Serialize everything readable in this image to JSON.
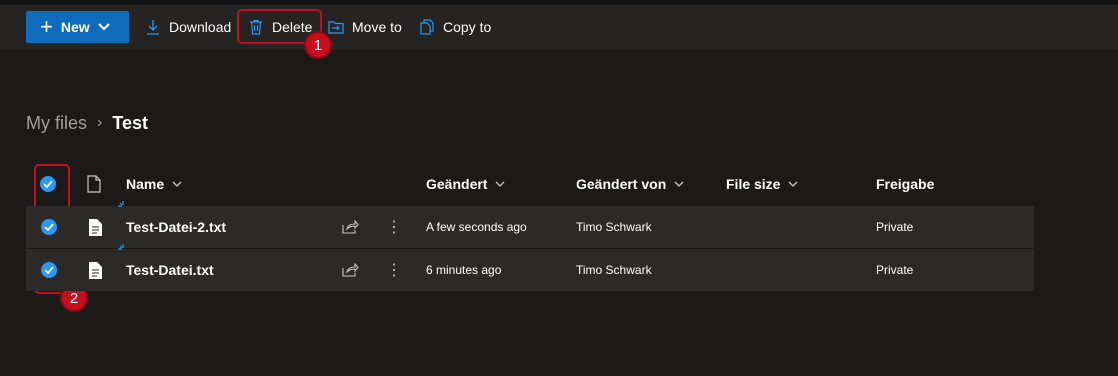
{
  "toolbar": {
    "new_label": "New",
    "download_label": "Download",
    "delete_label": "Delete",
    "move_label": "Move to",
    "copy_label": "Copy to"
  },
  "callouts": {
    "badge_1": "1",
    "badge_2": "2"
  },
  "breadcrumb": {
    "root": "My files",
    "current": "Test"
  },
  "columns": {
    "name": "Name",
    "modified": "Geändert",
    "modified_by": "Geändert von",
    "file_size": "File size",
    "sharing": "Freigabe"
  },
  "files": [
    {
      "name": "Test-Datei-2.txt",
      "modified": "A few seconds ago",
      "modified_by": "Timo Schwark",
      "file_size": "",
      "sharing": "Private",
      "selected": true
    },
    {
      "name": "Test-Datei.txt",
      "modified": "6 minutes ago",
      "modified_by": "Timo Schwark",
      "file_size": "",
      "sharing": "Private",
      "selected": true
    }
  ],
  "colors": {
    "accent": "#0f6cbd",
    "check": "#2899f5",
    "callout": "#c50f1f"
  }
}
